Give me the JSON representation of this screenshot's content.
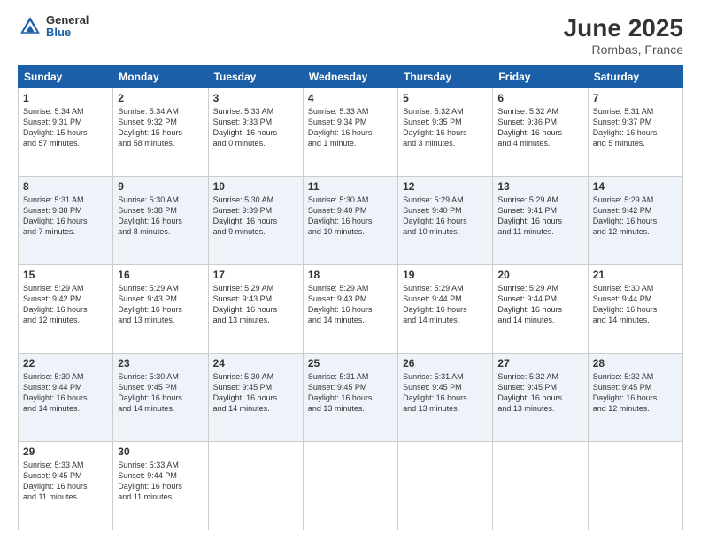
{
  "header": {
    "logo_general": "General",
    "logo_blue": "Blue",
    "title": "June 2025",
    "subtitle": "Rombas, France"
  },
  "days_of_week": [
    "Sunday",
    "Monday",
    "Tuesday",
    "Wednesday",
    "Thursday",
    "Friday",
    "Saturday"
  ],
  "weeks": [
    [
      {
        "day": "1",
        "text": "Sunrise: 5:34 AM\nSunset: 9:31 PM\nDaylight: 15 hours\nand 57 minutes."
      },
      {
        "day": "2",
        "text": "Sunrise: 5:34 AM\nSunset: 9:32 PM\nDaylight: 15 hours\nand 58 minutes."
      },
      {
        "day": "3",
        "text": "Sunrise: 5:33 AM\nSunset: 9:33 PM\nDaylight: 16 hours\nand 0 minutes."
      },
      {
        "day": "4",
        "text": "Sunrise: 5:33 AM\nSunset: 9:34 PM\nDaylight: 16 hours\nand 1 minute."
      },
      {
        "day": "5",
        "text": "Sunrise: 5:32 AM\nSunset: 9:35 PM\nDaylight: 16 hours\nand 3 minutes."
      },
      {
        "day": "6",
        "text": "Sunrise: 5:32 AM\nSunset: 9:36 PM\nDaylight: 16 hours\nand 4 minutes."
      },
      {
        "day": "7",
        "text": "Sunrise: 5:31 AM\nSunset: 9:37 PM\nDaylight: 16 hours\nand 5 minutes."
      }
    ],
    [
      {
        "day": "8",
        "text": "Sunrise: 5:31 AM\nSunset: 9:38 PM\nDaylight: 16 hours\nand 7 minutes."
      },
      {
        "day": "9",
        "text": "Sunrise: 5:30 AM\nSunset: 9:38 PM\nDaylight: 16 hours\nand 8 minutes."
      },
      {
        "day": "10",
        "text": "Sunrise: 5:30 AM\nSunset: 9:39 PM\nDaylight: 16 hours\nand 9 minutes."
      },
      {
        "day": "11",
        "text": "Sunrise: 5:30 AM\nSunset: 9:40 PM\nDaylight: 16 hours\nand 10 minutes."
      },
      {
        "day": "12",
        "text": "Sunrise: 5:29 AM\nSunset: 9:40 PM\nDaylight: 16 hours\nand 10 minutes."
      },
      {
        "day": "13",
        "text": "Sunrise: 5:29 AM\nSunset: 9:41 PM\nDaylight: 16 hours\nand 11 minutes."
      },
      {
        "day": "14",
        "text": "Sunrise: 5:29 AM\nSunset: 9:42 PM\nDaylight: 16 hours\nand 12 minutes."
      }
    ],
    [
      {
        "day": "15",
        "text": "Sunrise: 5:29 AM\nSunset: 9:42 PM\nDaylight: 16 hours\nand 12 minutes."
      },
      {
        "day": "16",
        "text": "Sunrise: 5:29 AM\nSunset: 9:43 PM\nDaylight: 16 hours\nand 13 minutes."
      },
      {
        "day": "17",
        "text": "Sunrise: 5:29 AM\nSunset: 9:43 PM\nDaylight: 16 hours\nand 13 minutes."
      },
      {
        "day": "18",
        "text": "Sunrise: 5:29 AM\nSunset: 9:43 PM\nDaylight: 16 hours\nand 14 minutes."
      },
      {
        "day": "19",
        "text": "Sunrise: 5:29 AM\nSunset: 9:44 PM\nDaylight: 16 hours\nand 14 minutes."
      },
      {
        "day": "20",
        "text": "Sunrise: 5:29 AM\nSunset: 9:44 PM\nDaylight: 16 hours\nand 14 minutes."
      },
      {
        "day": "21",
        "text": "Sunrise: 5:30 AM\nSunset: 9:44 PM\nDaylight: 16 hours\nand 14 minutes."
      }
    ],
    [
      {
        "day": "22",
        "text": "Sunrise: 5:30 AM\nSunset: 9:44 PM\nDaylight: 16 hours\nand 14 minutes."
      },
      {
        "day": "23",
        "text": "Sunrise: 5:30 AM\nSunset: 9:45 PM\nDaylight: 16 hours\nand 14 minutes."
      },
      {
        "day": "24",
        "text": "Sunrise: 5:30 AM\nSunset: 9:45 PM\nDaylight: 16 hours\nand 14 minutes."
      },
      {
        "day": "25",
        "text": "Sunrise: 5:31 AM\nSunset: 9:45 PM\nDaylight: 16 hours\nand 13 minutes."
      },
      {
        "day": "26",
        "text": "Sunrise: 5:31 AM\nSunset: 9:45 PM\nDaylight: 16 hours\nand 13 minutes."
      },
      {
        "day": "27",
        "text": "Sunrise: 5:32 AM\nSunset: 9:45 PM\nDaylight: 16 hours\nand 13 minutes."
      },
      {
        "day": "28",
        "text": "Sunrise: 5:32 AM\nSunset: 9:45 PM\nDaylight: 16 hours\nand 12 minutes."
      }
    ],
    [
      {
        "day": "29",
        "text": "Sunrise: 5:33 AM\nSunset: 9:45 PM\nDaylight: 16 hours\nand 11 minutes."
      },
      {
        "day": "30",
        "text": "Sunrise: 5:33 AM\nSunset: 9:44 PM\nDaylight: 16 hours\nand 11 minutes."
      },
      {
        "day": "",
        "text": ""
      },
      {
        "day": "",
        "text": ""
      },
      {
        "day": "",
        "text": ""
      },
      {
        "day": "",
        "text": ""
      },
      {
        "day": "",
        "text": ""
      }
    ]
  ]
}
